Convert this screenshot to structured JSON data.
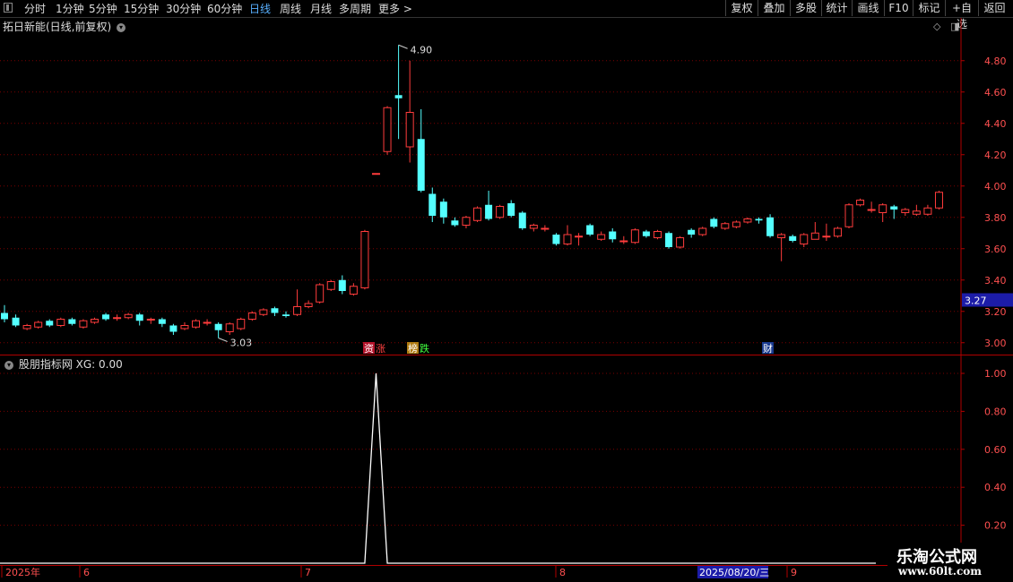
{
  "toolbar": {
    "periods": [
      "分时",
      "1分钟",
      "5分钟",
      "15分钟",
      "30分钟",
      "60分钟",
      "日线",
      "周线",
      "月线",
      "多周期",
      "更多 >"
    ],
    "active_period": "日线",
    "right_buttons": [
      "复权",
      "叠加",
      "多股",
      "统计",
      "画线",
      "F10",
      "标记",
      "+自选",
      "返回"
    ]
  },
  "main_chart": {
    "title": "拓日新能(日线,前复权)",
    "price_axis": [
      "4.80",
      "4.60",
      "4.40",
      "4.20",
      "4.00",
      "3.80",
      "3.60",
      "3.40",
      "3.20",
      "3.00"
    ],
    "current_price": "3.27",
    "high_label": "4.90",
    "low_label": "3.03",
    "event_tags": [
      {
        "text": "资",
        "bg": "#b4122a",
        "color": "#fff"
      },
      {
        "text": "涨",
        "bg": "#000",
        "color": "#ff4040"
      },
      {
        "text": "榜",
        "bg": "#b07a10",
        "color": "#fff"
      },
      {
        "text": "跌",
        "bg": "#000",
        "color": "#40ff40"
      },
      {
        "text": "财",
        "bg": "#1a3a90",
        "color": "#fff"
      }
    ]
  },
  "indicator": {
    "title": "股朋指标网 XG: 0.00",
    "axis": [
      "1.00",
      "0.80",
      "0.60",
      "0.40",
      "0.20"
    ]
  },
  "date_axis": {
    "labels": [
      "2025年",
      "6",
      "7",
      "8",
      "9"
    ],
    "cursor_date": "2025/08/20/三"
  },
  "watermark": {
    "line1": "乐淘公式网",
    "line2": "www.60lt.com"
  },
  "colors": {
    "up": "#ff3c3c",
    "down": "#54ffff",
    "grid": "#7a0000",
    "axis": "#b00000",
    "active": "#58b0ff"
  },
  "chart_data": {
    "type": "candlestick",
    "price_range": [
      2.93,
      4.97
    ],
    "indicator_series": {
      "name": "XG",
      "signal_index": 33,
      "value": 1.0
    },
    "candles": [
      [
        3.19,
        3.15,
        3.24,
        3.13
      ],
      [
        3.16,
        3.11,
        3.18,
        3.1
      ],
      [
        3.09,
        3.11,
        3.12,
        3.08
      ],
      [
        3.1,
        3.13,
        3.14,
        3.09
      ],
      [
        3.14,
        3.11,
        3.15,
        3.1
      ],
      [
        3.11,
        3.15,
        3.16,
        3.1
      ],
      [
        3.15,
        3.12,
        3.16,
        3.11
      ],
      [
        3.1,
        3.14,
        3.15,
        3.09
      ],
      [
        3.13,
        3.15,
        3.16,
        3.12
      ],
      [
        3.18,
        3.15,
        3.19,
        3.14
      ],
      [
        3.16,
        3.16,
        3.18,
        3.14
      ],
      [
        3.16,
        3.18,
        3.19,
        3.15
      ],
      [
        3.18,
        3.14,
        3.19,
        3.11
      ],
      [
        3.15,
        3.15,
        3.16,
        3.12
      ],
      [
        3.15,
        3.12,
        3.16,
        3.1
      ],
      [
        3.11,
        3.07,
        3.12,
        3.05
      ],
      [
        3.09,
        3.11,
        3.13,
        3.08
      ],
      [
        3.1,
        3.14,
        3.15,
        3.09
      ],
      [
        3.13,
        3.13,
        3.15,
        3.11
      ],
      [
        3.12,
        3.08,
        3.13,
        3.03
      ],
      [
        3.07,
        3.12,
        3.13,
        3.05
      ],
      [
        3.09,
        3.15,
        3.16,
        3.08
      ],
      [
        3.15,
        3.19,
        3.2,
        3.14
      ],
      [
        3.18,
        3.21,
        3.22,
        3.17
      ],
      [
        3.22,
        3.19,
        3.23,
        3.17
      ],
      [
        3.18,
        3.17,
        3.2,
        3.16
      ],
      [
        3.18,
        3.23,
        3.34,
        3.17
      ],
      [
        3.23,
        3.25,
        3.27,
        3.22
      ],
      [
        3.26,
        3.37,
        3.38,
        3.25
      ],
      [
        3.34,
        3.39,
        3.4,
        3.33
      ],
      [
        3.4,
        3.33,
        3.43,
        3.31
      ],
      [
        3.31,
        3.36,
        3.38,
        3.3
      ],
      [
        3.35,
        3.71,
        3.72,
        3.34
      ],
      [
        4.08,
        4.08,
        4.08,
        4.08
      ],
      [
        4.22,
        4.5,
        4.51,
        4.2
      ],
      [
        4.58,
        4.56,
        4.9,
        4.3
      ],
      [
        4.25,
        4.47,
        4.8,
        4.15
      ],
      [
        4.3,
        3.97,
        4.49,
        3.96
      ],
      [
        3.95,
        3.81,
        3.99,
        3.77
      ],
      [
        3.9,
        3.8,
        3.92,
        3.76
      ],
      [
        3.78,
        3.75,
        3.8,
        3.74
      ],
      [
        3.75,
        3.8,
        3.81,
        3.73
      ],
      [
        3.78,
        3.86,
        3.87,
        3.77
      ],
      [
        3.88,
        3.79,
        3.97,
        3.78
      ],
      [
        3.8,
        3.87,
        3.88,
        3.79
      ],
      [
        3.89,
        3.81,
        3.91,
        3.8
      ],
      [
        3.83,
        3.73,
        3.84,
        3.72
      ],
      [
        3.73,
        3.75,
        3.76,
        3.71
      ],
      [
        3.73,
        3.73,
        3.75,
        3.71
      ],
      [
        3.69,
        3.63,
        3.7,
        3.62
      ],
      [
        3.63,
        3.69,
        3.75,
        3.62
      ],
      [
        3.68,
        3.68,
        3.7,
        3.62
      ],
      [
        3.75,
        3.69,
        3.76,
        3.68
      ],
      [
        3.66,
        3.69,
        3.71,
        3.65
      ],
      [
        3.71,
        3.66,
        3.73,
        3.64
      ],
      [
        3.65,
        3.65,
        3.68,
        3.63
      ],
      [
        3.64,
        3.72,
        3.73,
        3.63
      ],
      [
        3.71,
        3.68,
        3.72,
        3.67
      ],
      [
        3.67,
        3.71,
        3.72,
        3.66
      ],
      [
        3.7,
        3.61,
        3.71,
        3.6
      ],
      [
        3.61,
        3.67,
        3.68,
        3.6
      ],
      [
        3.72,
        3.69,
        3.73,
        3.67
      ],
      [
        3.69,
        3.73,
        3.74,
        3.68
      ],
      [
        3.79,
        3.74,
        3.8,
        3.73
      ],
      [
        3.73,
        3.76,
        3.77,
        3.72
      ],
      [
        3.74,
        3.77,
        3.78,
        3.73
      ],
      [
        3.77,
        3.79,
        3.8,
        3.76
      ],
      [
        3.79,
        3.78,
        3.8,
        3.76
      ],
      [
        3.8,
        3.68,
        3.82,
        3.67
      ],
      [
        3.67,
        3.69,
        3.7,
        3.52
      ],
      [
        3.68,
        3.65,
        3.69,
        3.64
      ],
      [
        3.63,
        3.69,
        3.7,
        3.61
      ],
      [
        3.66,
        3.7,
        3.77,
        3.66
      ],
      [
        3.68,
        3.68,
        3.76,
        3.65
      ],
      [
        3.68,
        3.73,
        3.74,
        3.67
      ],
      [
        3.74,
        3.88,
        3.89,
        3.73
      ],
      [
        3.88,
        3.91,
        3.92,
        3.87
      ],
      [
        3.85,
        3.85,
        3.9,
        3.83
      ],
      [
        3.83,
        3.88,
        3.89,
        3.77
      ],
      [
        3.87,
        3.85,
        3.88,
        3.79
      ],
      [
        3.83,
        3.85,
        3.86,
        3.81
      ],
      [
        3.82,
        3.84,
        3.88,
        3.81
      ],
      [
        3.82,
        3.86,
        3.88,
        3.81
      ],
      [
        3.86,
        3.96,
        3.97,
        3.85
      ]
    ]
  }
}
